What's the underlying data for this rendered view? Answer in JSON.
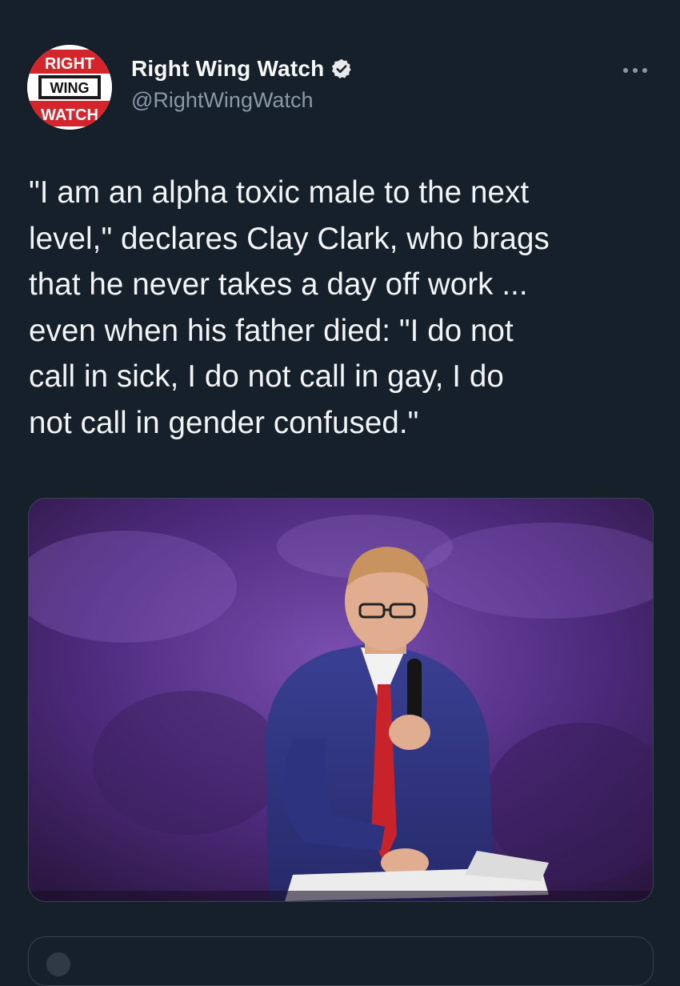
{
  "author": {
    "display_name": "Right Wing Watch",
    "handle": "@RightWingWatch",
    "verified": true,
    "avatar_logo": {
      "line1": "RIGHT",
      "line2": "WING",
      "line3": "WATCH"
    },
    "avatar_icon": "right-wing-watch-logo",
    "verified_icon": "verified-badge-icon"
  },
  "more_icon": "more-dots-icon",
  "tweet": {
    "text": "\"I am an alpha toxic male to the next\nlevel,\" declares Clay Clark, who brags\nthat he never takes a day off work ...\neven when his father died: \"I do not\ncall in sick, I do not call in gay, I do\nnot call in gender confused.\""
  },
  "media": {
    "type": "photo"
  },
  "colors": {
    "background": "#15202b",
    "text": "#e7e9ea",
    "secondary_text": "#8b98a5",
    "verified": "#e7e9ea",
    "logo_red": "#d4252c"
  }
}
